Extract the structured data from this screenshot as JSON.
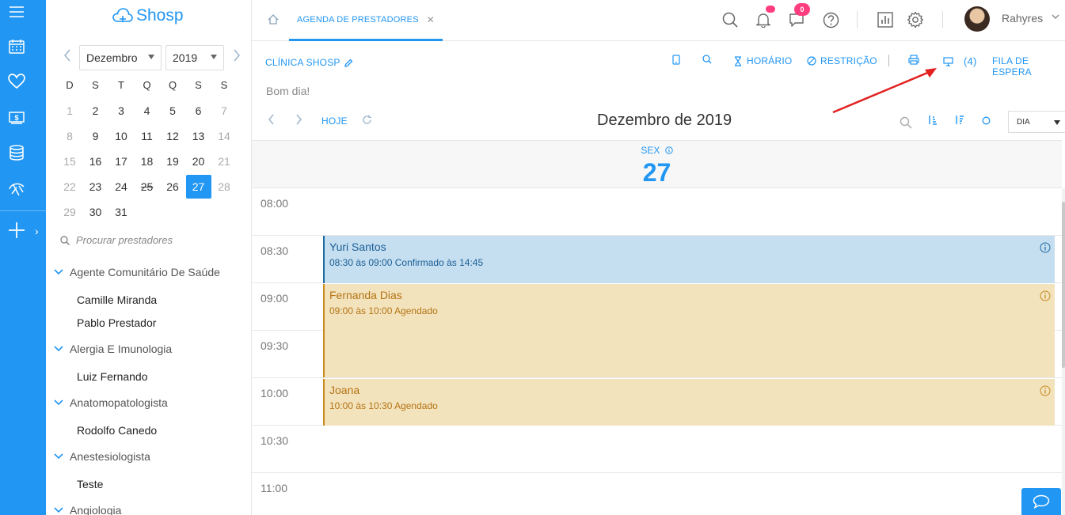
{
  "app": {
    "logo_text": "Shosp"
  },
  "calendar": {
    "month": "Dezembro",
    "year": "2019",
    "weekdays": [
      "D",
      "S",
      "T",
      "Q",
      "Q",
      "S",
      "S"
    ],
    "weeks": [
      [
        "1",
        "2",
        "3",
        "4",
        "5",
        "6",
        "7"
      ],
      [
        "8",
        "9",
        "10",
        "11",
        "12",
        "13",
        "14"
      ],
      [
        "15",
        "16",
        "17",
        "18",
        "19",
        "20",
        "21"
      ],
      [
        "22",
        "23",
        "24",
        "25",
        "26",
        "27",
        "28"
      ],
      [
        "29",
        "30",
        "31"
      ]
    ],
    "selected_day": "27"
  },
  "search": {
    "placeholder": "Procurar prestadores"
  },
  "specialties": [
    {
      "name": "Agente Comunitário De Saúde",
      "providers": [
        "Camille Miranda",
        "Pablo Prestador"
      ]
    },
    {
      "name": "Alergia E Imunologia",
      "providers": [
        "Luiz Fernando"
      ]
    },
    {
      "name": "Anatomopatologista",
      "providers": [
        "Rodolfo Canedo"
      ]
    },
    {
      "name": "Anestesiologista",
      "providers": [
        "Teste"
      ]
    },
    {
      "name": "Angiologia",
      "providers": []
    }
  ],
  "header": {
    "tab_label": "AGENDA DE PRESTADORES",
    "chat_badge": "0",
    "user_name": "Rahyres"
  },
  "toolbar": {
    "clinic": "CLÍNICA SHOSP",
    "horario": "HORÁRIO",
    "restricao": "RESTRIÇÃO",
    "monitor_count": "(4)",
    "fila": "FILA DE ESPERA",
    "greeting": "Bom dia!",
    "hoje": "HOJE",
    "month_title": "Dezembro de 2019",
    "view": "DIA"
  },
  "day": {
    "name": "SEX",
    "number": "27"
  },
  "time_slots": [
    "08:00",
    "08:30",
    "09:00",
    "09:30",
    "10:00",
    "10:30",
    "11:00"
  ],
  "events": [
    {
      "name": "Yuri Santos",
      "detail": "08:30 às 09:00 Confirmado às 14:45",
      "status": "confirmado",
      "color": "#c5def0"
    },
    {
      "name": "Fernanda Dias",
      "detail": "09:00 às 10:00 Agendado",
      "status": "agendado",
      "color": "#f2e3bd"
    },
    {
      "name": "Joana",
      "detail": "10:00 às 10:30 Agendado",
      "status": "agendado",
      "color": "#f2e3bd"
    }
  ],
  "colors": {
    "accent": "#2196f3",
    "badge": "#ff3d7f"
  }
}
